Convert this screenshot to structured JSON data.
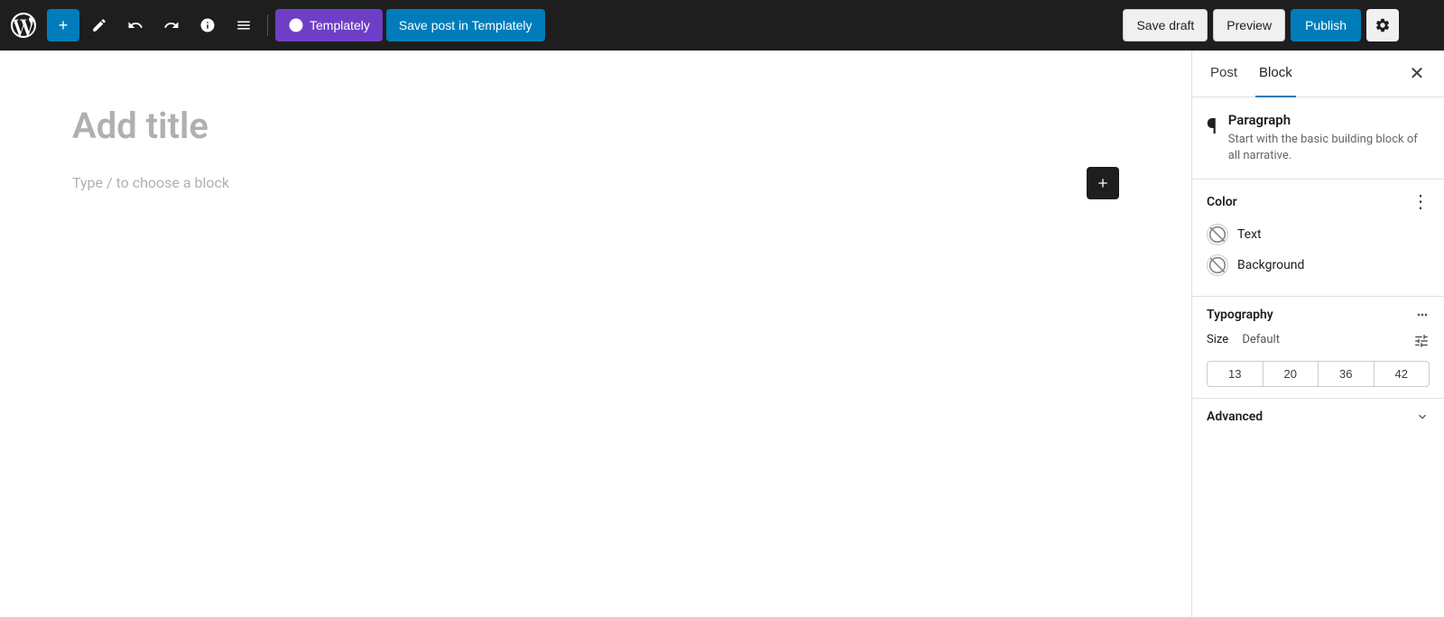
{
  "toolbar": {
    "add_label": "+",
    "pencil_label": "✏",
    "undo_label": "↩",
    "redo_label": "↪",
    "info_label": "ℹ",
    "list_label": "≡",
    "templately_label": "Templately",
    "save_post_label": "Save post in Templately",
    "save_draft_label": "Save draft",
    "preview_label": "Preview",
    "publish_label": "Publish",
    "settings_label": "⚙",
    "more_label": "⋮"
  },
  "editor": {
    "title_placeholder": "Add title",
    "block_placeholder": "Type / to choose a block"
  },
  "sidebar": {
    "post_tab": "Post",
    "block_tab": "Block",
    "close_label": "✕",
    "block_info": {
      "icon": "¶",
      "name": "Paragraph",
      "description": "Start with the basic building block of all narrative."
    },
    "color_section": {
      "title": "Color",
      "more_icon": "⋮",
      "text_label": "Text",
      "background_label": "Background"
    },
    "typography_section": {
      "title": "Typography",
      "more_icon": "⋮",
      "size_label": "Size",
      "size_default": "Default",
      "sizes": [
        "13",
        "20",
        "36",
        "42"
      ],
      "controls_icon": "⇌"
    },
    "advanced_section": {
      "title": "Advanced",
      "chevron": "∨"
    }
  }
}
